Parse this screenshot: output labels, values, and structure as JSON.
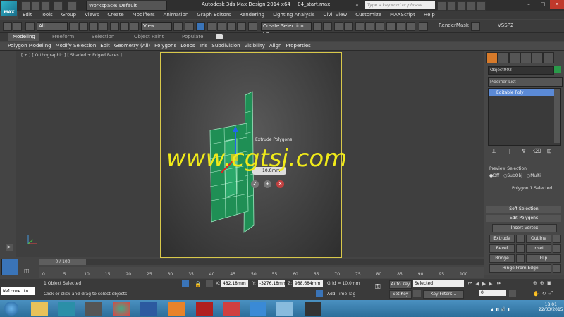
{
  "titlebar": {
    "workspace": "Workspace: Default",
    "app_title": "Autodesk 3ds Max Design 2014 x64",
    "file_name": "04_start.max",
    "search_placeholder": "Type a keyword or phrase",
    "logo_text": "MAX"
  },
  "menu": [
    "Edit",
    "Tools",
    "Group",
    "Views",
    "Create",
    "Modifiers",
    "Animation",
    "Graph Editors",
    "Rendering",
    "Lighting Analysis",
    "Civil View",
    "Customize",
    "MAXScript",
    "Help"
  ],
  "toolbar": {
    "filter": "All",
    "ref_coord": "View",
    "selection_set": "Create Selection Se",
    "render_mask": "RenderMask",
    "vssp": "VSSP2"
  },
  "ribbon": {
    "tabs": [
      "Modeling",
      "Freeform",
      "Selection",
      "Object Paint",
      "Populate"
    ],
    "items": [
      "Polygon Modeling",
      "Modify Selection",
      "Edit",
      "Geometry (All)",
      "Polygons",
      "Loops",
      "Tris",
      "Subdivision",
      "Visibility",
      "Align",
      "Properties"
    ]
  },
  "viewport": {
    "label": "[ + ] [ Orthographic ] [ Shaded + Edged Faces ]",
    "caddy_title": "Extrude Polygons",
    "caddy_value": "10.0mm"
  },
  "watermark": "www.cgtsj.com",
  "command_panel": {
    "object_name": "Object002",
    "object_color": "#2a9a4a",
    "modifier_list": "Modifier List",
    "stack_item": "Editable Poly",
    "preview_selection": "Preview Selection",
    "preview_opts": [
      "Off",
      "SubObj",
      "Multi"
    ],
    "selection_info": "Polygon 1 Selected",
    "soft_selection": "Soft Selection",
    "edit_polygons": "Edit Polygons",
    "insert_vertex": "Insert Vertex",
    "buttons": [
      [
        "Extrude",
        "Outline"
      ],
      [
        "Bevel",
        "Inset"
      ],
      [
        "Bridge",
        "Flip"
      ]
    ],
    "hinge": "Hinge From Edge"
  },
  "timeline": {
    "slider": "0 / 100",
    "ticks": [
      "0",
      "5",
      "10",
      "15",
      "20",
      "25",
      "30",
      "35",
      "40",
      "45",
      "50",
      "55",
      "60",
      "65",
      "70",
      "75",
      "80",
      "85",
      "90",
      "95",
      "100"
    ]
  },
  "status": {
    "maxscript": "Welcome to",
    "selected": "1 Object Selected",
    "prompt": "Click or click-and-drag to select objects",
    "x_label": "X:",
    "x": "482.18mm",
    "y_label": "Y:",
    "y": "-3276.18mm",
    "z_label": "Z:",
    "z": "988.684mm",
    "grid": "Grid = 10.0mm",
    "add_time_tag": "Add Time Tag",
    "auto_key": "Auto Key",
    "key_mode": "Selected",
    "set_key": "Set Key",
    "key_filters": "Key Filters...",
    "frame": "0"
  },
  "taskbar": {
    "time": "18:01",
    "date": "22/03/2015"
  }
}
